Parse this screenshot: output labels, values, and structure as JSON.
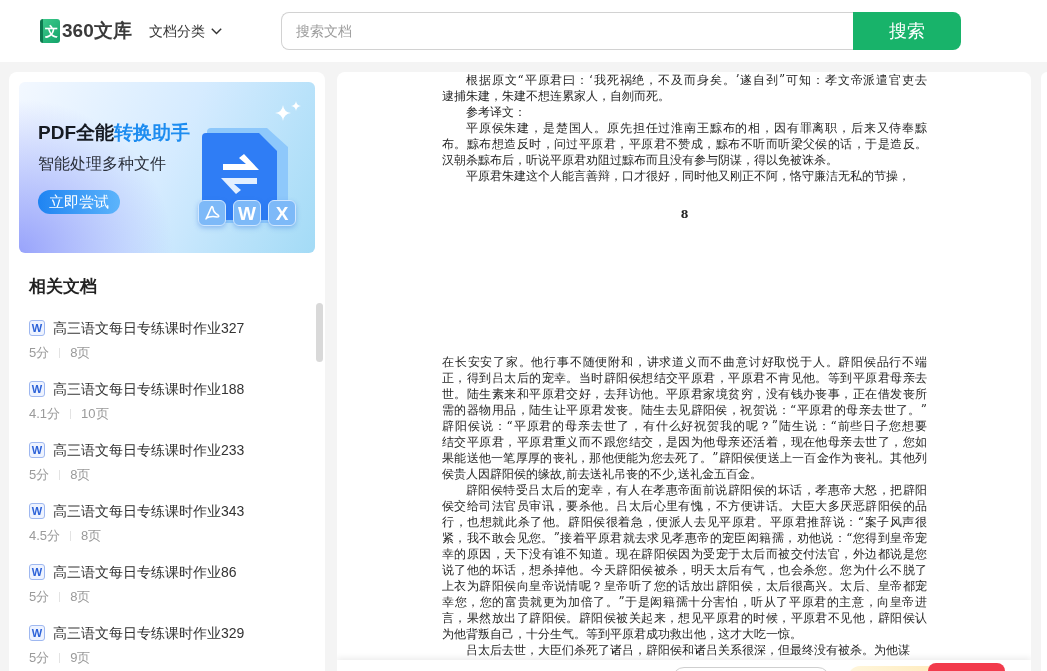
{
  "header": {
    "logo": {
      "mark": "文",
      "text": "360文库"
    },
    "category_menu": "文档分类",
    "search": {
      "placeholder": "搜索文档",
      "button": "搜索"
    }
  },
  "banner": {
    "title_parts": [
      {
        "text": "PDF全能",
        "highlight": false
      },
      {
        "text": "转换助手",
        "highlight": true
      }
    ],
    "subtitle": "智能处理多种文件",
    "button": "立即尝试",
    "file_tiles": [
      {
        "kind": "pdf"
      },
      {
        "kind": "letter",
        "text": "W"
      },
      {
        "kind": "letter",
        "text": "X"
      }
    ]
  },
  "related_docs": {
    "title": "相关文档",
    "items": [
      {
        "type": "W",
        "title": "高三语文每日专练课时作业327",
        "score": "5分",
        "pages": "8页"
      },
      {
        "type": "W",
        "title": "高三语文每日专练课时作业188",
        "score": "4.1分",
        "pages": "10页"
      },
      {
        "type": "W",
        "title": "高三语文每日专练课时作业233",
        "score": "5分",
        "pages": "8页"
      },
      {
        "type": "W",
        "title": "高三语文每日专练课时作业343",
        "score": "4.5分",
        "pages": "8页"
      },
      {
        "type": "W",
        "title": "高三语文每日专练课时作业86",
        "score": "5分",
        "pages": "8页"
      },
      {
        "type": "W",
        "title": "高三语文每日专练课时作业329",
        "score": "5分",
        "pages": "9页"
      }
    ]
  },
  "document": {
    "pages": [
      {
        "paragraphs": [
          {
            "indented": true,
            "lines": [
              "根据原文“平原君曰：‘我死祸绝，不及而身矣。’遂自刭”可知：孝文帝派遣官吏去",
              "逮捕朱建，朱建不想连累家人，自刎而死。"
            ]
          },
          {
            "indented": true,
            "lines": [
              "参考译文："
            ]
          },
          {
            "indented": true,
            "lines": [
              "平原侯朱建，是楚国人。原先担任过淮南王黥布的相，因有罪离职，后来又侍奉黥",
              "布。黥布想造反时，问过平原君，平原君不赞成，黥布不听而听梁父侯的话，于是造反。",
              "汉朝杀黥布后，听说平原君劝阻过黥布而且没有参与阴谋，得以免被诛杀。"
            ]
          },
          {
            "indented": true,
            "lines": [
              "平原君朱建这个人能言善辩，口才很好，同时他又刚正不阿，恪守廉洁无私的节操，"
            ]
          }
        ],
        "page_number": "8"
      },
      {
        "paragraphs": [
          {
            "indented": false,
            "lines": [
              "在长安安了家。他行事不随便附和，讲求道义而不曲意讨好取悦于人。辟阳侯品行不端",
              "正，得到吕太后的宠幸。当时辟阳侯想结交平原君，平原君不肯见他。等到平原君母亲去",
              "世。陆生素来和平原君交好，去拜访他。平原君家境贫穷，没有钱办丧事，正在借发丧所",
              "需的器物用品，陆生让平原君发丧。陆生去见辟阳侯，祝贺说：“平原君的母亲去世了。”",
              "辟阳侯说：“平原君的母亲去世了，有什么好祝贺我的呢？”陆生说：“前些日子您想要",
              "结交平原君，平原君重义而不跟您结交，是因为他母亲还活着，现在他母亲去世了，您如",
              "果能送他一笔厚厚的丧礼，那他便能为您去死了。”辟阳侯便送上一百金作为丧礼。其他列",
              "侯贵人因辟阳侯的缘故,前去送礼吊丧的不少,送礼金五百金。"
            ]
          },
          {
            "indented": true,
            "lines": [
              "辟阳侯特受吕太后的宠幸，有人在孝惠帝面前说辟阳侯的坏话，孝惠帝大怒，把辟阳",
              "侯交给司法官员审讯，要杀他。吕太后心里有愧，不方便讲话。大臣大多厌恶辟阳侯的品",
              "行，也想就此杀了他。辟阳侯很着急，便派人去见平原君。平原君推辞说：“案子风声很",
              "紧，我不敢会见您。”接着平原君就去求见孝惠帝的宠臣闳籍孺，劝他说：“您得到皇帝宠",
              "幸的原因，天下没有谁不知道。现在辟阳侯因为受宠于太后而被交付法官，外边都说是您",
              "说了他的坏话，想杀掉他。今天辟阳侯被杀，明天太后有气，也会杀您。您为什么不脱了",
              "上衣为辟阳侯向皇帝说情呢？皇帝听了您的话放出辟阳侯，太后很高兴。太后、皇帝都宠",
              "幸您，您的富贵就更为加倍了。”于是闳籍孺十分害怕，听从了平原君的主意，向皇帝进",
              "言，果然放出了辟阳侯。辟阳侯被关起来，想见平原君的时候，平原君不见他，辟阳侯认",
              "为他背叛自己，十分生气。等到平原君成功救出他，这才大吃一惊。"
            ]
          },
          {
            "indented": true,
            "lines": [
              "吕太后去世，大臣们杀死了诸吕，辟阳侯和诸吕关系很深，但最终没有被杀。为他谋"
            ]
          }
        ]
      }
    ]
  }
}
